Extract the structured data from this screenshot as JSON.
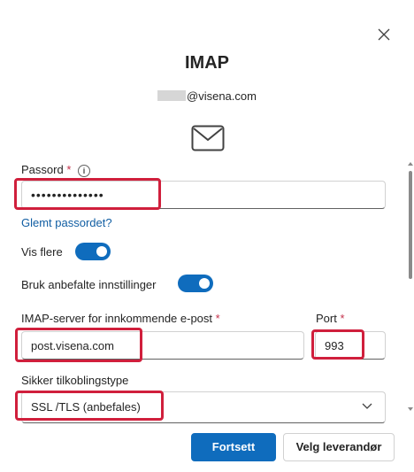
{
  "dialog": {
    "title": "IMAP",
    "account_domain": "@visena.com"
  },
  "password": {
    "label": "Passord",
    "required_mark": "*",
    "info_glyph": "i",
    "value": "••••••••••••••",
    "forgot_link": "Glemt passordet?"
  },
  "toggles": {
    "show_more_label": "Vis flere",
    "show_more_on": true,
    "recommended_label": "Bruk anbefalte innstillinger",
    "recommended_on": true
  },
  "server": {
    "incoming_label": "IMAP-server for innkommende e-post",
    "required_mark": "*",
    "incoming_value": "post.visena.com",
    "port_label": "Port",
    "port_value": "993"
  },
  "security": {
    "label": "Sikker tilkoblingstype",
    "selected": "SSL /TLS (anbefales)"
  },
  "buttons": {
    "continue": "Fortsett",
    "choose_provider": "Velg leverandør"
  },
  "colors": {
    "accent": "#0f6cbd",
    "highlight": "#d01f3c",
    "link": "#115ea3",
    "required": "#c4314b"
  },
  "icons": {
    "close": "close-icon",
    "mail": "mail-envelope-icon",
    "info": "info-icon",
    "dropdown": "chevron-down-icon"
  }
}
